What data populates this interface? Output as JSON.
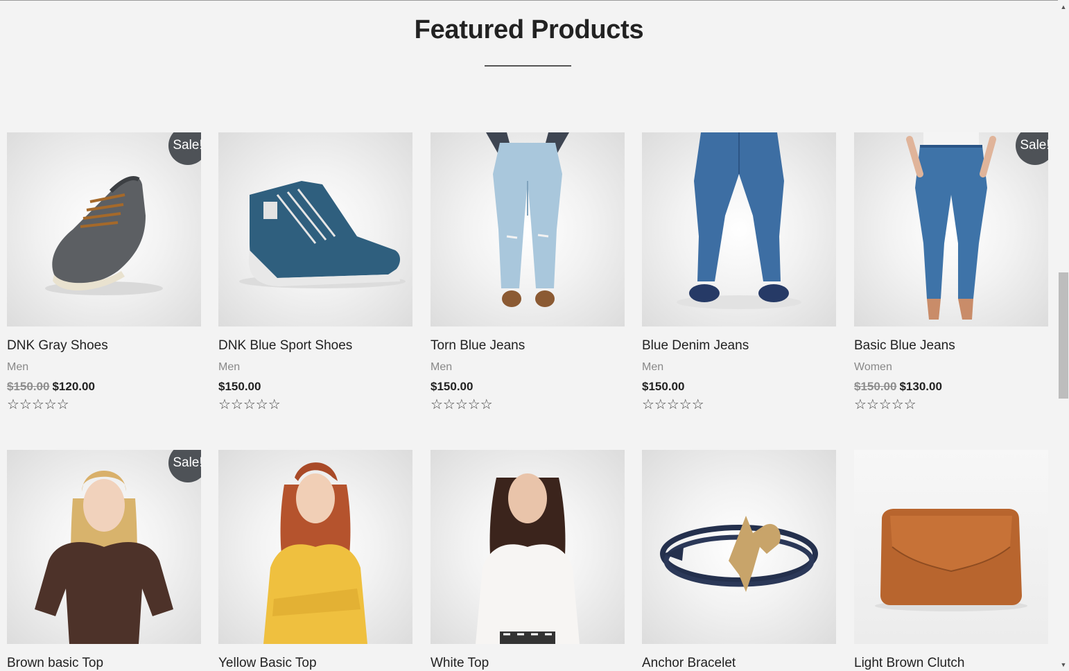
{
  "section": {
    "title": "Featured Products"
  },
  "products": [
    {
      "name": "DNK Gray Shoes",
      "category": "Men",
      "old_price": "$150.00",
      "price": "$120.00",
      "sale": "Sale!",
      "rating_stars": "☆☆☆☆☆",
      "image_icon": "gray-shoe-icon"
    },
    {
      "name": "DNK Blue Sport Shoes",
      "category": "Men",
      "old_price": "",
      "price": "$150.00",
      "sale": "",
      "rating_stars": "☆☆☆☆☆",
      "image_icon": "blue-sneaker-icon"
    },
    {
      "name": "Torn Blue Jeans",
      "category": "Men",
      "old_price": "",
      "price": "$150.00",
      "sale": "",
      "rating_stars": "☆☆☆☆☆",
      "image_icon": "torn-jeans-icon"
    },
    {
      "name": "Blue Denim Jeans",
      "category": "Men",
      "old_price": "",
      "price": "$150.00",
      "sale": "",
      "rating_stars": "☆☆☆☆☆",
      "image_icon": "denim-jeans-icon"
    },
    {
      "name": "Basic Blue Jeans",
      "category": "Women",
      "old_price": "$150.00",
      "price": "$130.00",
      "sale": "Sale!",
      "rating_stars": "☆☆☆☆☆",
      "image_icon": "womens-jeans-icon"
    },
    {
      "name": "Brown basic Top",
      "sale": "Sale!",
      "image_icon": "brown-top-icon"
    },
    {
      "name": "Yellow Basic Top",
      "sale": "",
      "image_icon": "yellow-top-icon"
    },
    {
      "name": "White Top",
      "sale": "",
      "image_icon": "white-top-icon"
    },
    {
      "name": "Anchor Bracelet",
      "sale": "",
      "image_icon": "anchor-bracelet-icon"
    },
    {
      "name": "Light Brown Clutch",
      "sale": "",
      "image_icon": "brown-clutch-icon"
    }
  ],
  "colors": {
    "badge": "#4e5257",
    "background": "#f3f3f3",
    "muted_text": "#888888"
  },
  "scrollbar": {
    "position_fraction": 0.41
  }
}
